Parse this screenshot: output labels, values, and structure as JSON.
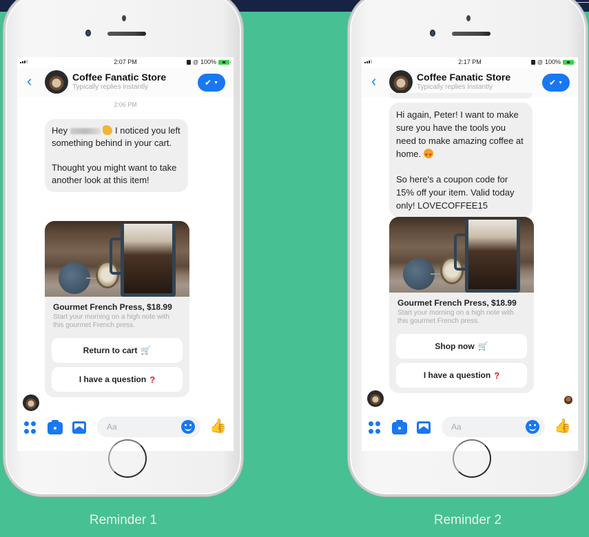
{
  "colors": {
    "background": "#47c093",
    "topbar": "#172345",
    "messenger_blue": "#1877f2",
    "bubble": "#efefef"
  },
  "phones": [
    {
      "caption": "Reminder 1",
      "status": {
        "time": "2:07 PM",
        "battery": "100%"
      },
      "header": {
        "name": "Coffee Fanatic Store",
        "subtitle": "Typically replies instantly",
        "back_icon": "chevron-left-icon",
        "action_icon": "check-dropdown-icon"
      },
      "timestamp": "2:06 PM",
      "message": {
        "p1_before": "Hey",
        "p1_after": "I noticed you left something behind in your cart.",
        "p2": "Thought you might want to take another look at this item!"
      },
      "card": {
        "title": "Gourmet French Press, $18.99",
        "description": "Start your morning on a high note with this gourmet French press.",
        "buttons": [
          {
            "label": "Return to cart",
            "icon": "cart-icon"
          },
          {
            "label": "I have a question",
            "icon": "question-icon"
          }
        ]
      },
      "composer": {
        "placeholder": "Aa"
      }
    },
    {
      "caption": "Reminder 2",
      "status": {
        "time": "2:17 PM",
        "battery": "100%"
      },
      "header": {
        "name": "Coffee Fanatic Store",
        "subtitle": "Typically replies instantly",
        "back_icon": "chevron-left-icon",
        "action_icon": "check-dropdown-icon"
      },
      "message": {
        "p1": "Hi again, Peter! I want to make sure you have the tools you need to make amazing coffee at home.",
        "p2": "So here's a coupon code for 15% off your item. Valid today only! LOVECOFFEE15"
      },
      "card": {
        "title": "Gourmet French Press, $18.99",
        "description": "Start your morning on a high note with this gourmet French press.",
        "buttons": [
          {
            "label": "Shop now",
            "icon": "cart-icon"
          },
          {
            "label": "I have a question",
            "icon": "question-icon"
          }
        ]
      },
      "composer": {
        "placeholder": "Aa"
      }
    }
  ]
}
